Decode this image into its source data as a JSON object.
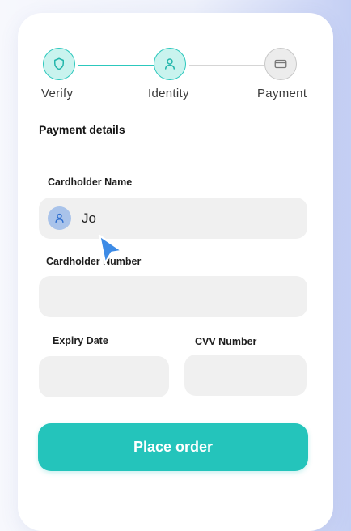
{
  "stepper": {
    "steps": [
      {
        "label": "Verify",
        "icon": "shield-icon",
        "state": "completed"
      },
      {
        "label": "Identity",
        "icon": "user-icon",
        "state": "current"
      },
      {
        "label": "Payment",
        "icon": "credit-card-icon",
        "state": "pending"
      }
    ]
  },
  "form": {
    "title": "Payment details",
    "cardholder_name": {
      "label": "Cardholder Name",
      "value": "Jo",
      "icon": "user-icon"
    },
    "cardholder_number": {
      "label": "Cardholder Number",
      "value": ""
    },
    "expiry_date": {
      "label": "Expiry Date",
      "value": ""
    },
    "cvv_number": {
      "label": "CVV Number",
      "value": ""
    },
    "submit_label": "Place order"
  },
  "colors": {
    "accent": "#24c4bb",
    "step_done_fill": "#c9f3ee",
    "step_pending_fill": "#ececec",
    "input_background": "#f0f0f0",
    "cursor": "#3d8be6"
  }
}
